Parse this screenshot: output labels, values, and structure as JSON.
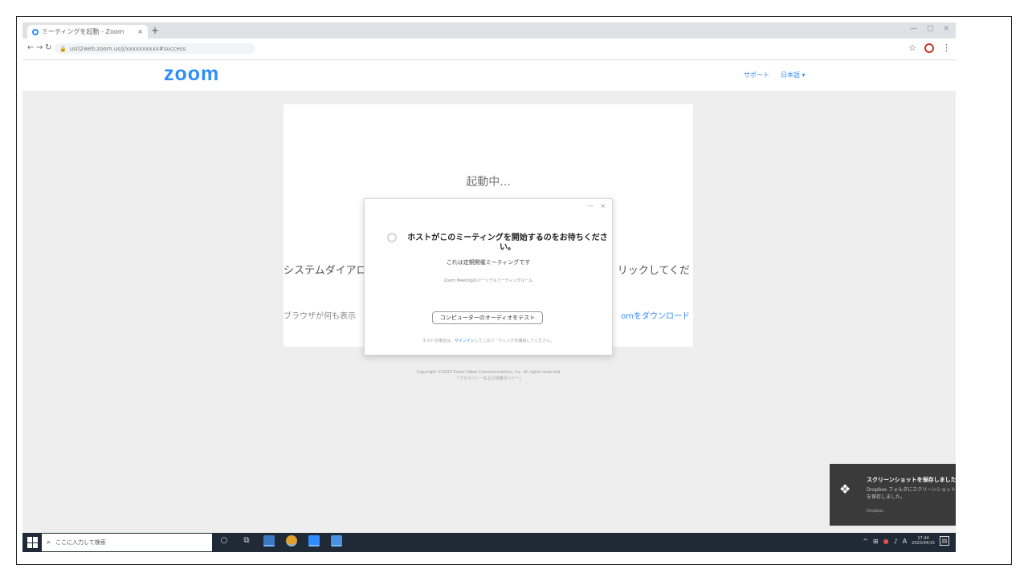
{
  "browser": {
    "tab_title": "ミーティングを起動 - Zoom",
    "tab_close": "×",
    "new_tab": "+",
    "url": "us02web.zoom.us/j/xxxxxxxxxx#success",
    "window_controls": [
      "—",
      "□",
      "×"
    ]
  },
  "zoom": {
    "logo": "zoom",
    "header_links": [
      "サポート",
      "日本語 ▾"
    ]
  },
  "card": {
    "launching": "起動中...",
    "message_left": "システムダイアロ",
    "message_right": "リックしてくだ",
    "note_left": "ブラウザが何も表示",
    "link_right": "omをダウンロード"
  },
  "footer": {
    "line1": "Copyright ©2020 Zoom Video Communications, Inc. All rights reserved.",
    "line2": "「プライバシーおよび法務ポリシー」"
  },
  "modal": {
    "controls": [
      "—",
      "×"
    ],
    "title": "ホストがこのミーティングを開始するのをお待ちください。",
    "subtitle": "これは定期開催ミーティングです",
    "meeting_name": "Zoom Meetingのパーソナルミーティングルーム",
    "button": "コンピューターのオーディオをテスト",
    "note_prefix": "ホストの場合は、",
    "note_link": "サインイン",
    "note_suffix": "してこのミーティングを開始してください。"
  },
  "toast": {
    "title": "スクリーンショットを保存しました",
    "body_line1": "Dropbox フォルダにスクリーンショット",
    "body_line2": "を保存しました。",
    "source": "Dropbox"
  },
  "taskbar": {
    "search_placeholder": "ここに入力して検索",
    "clock_time": "17:44",
    "clock_date": "2020/04/15"
  }
}
